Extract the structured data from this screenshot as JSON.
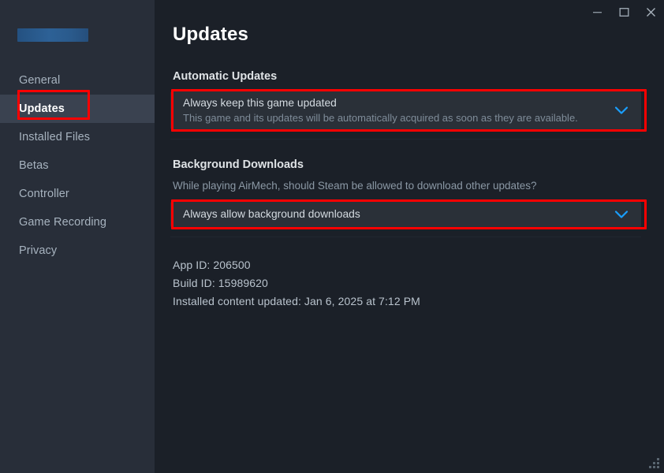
{
  "window": {
    "controls": [
      {
        "name": "minimize",
        "glyph": "minimize-icon"
      },
      {
        "name": "maximize",
        "glyph": "maximize-icon"
      },
      {
        "name": "close",
        "glyph": "close-icon"
      }
    ]
  },
  "sidebar": {
    "game_title_redacted": "",
    "items": [
      {
        "label": "General",
        "active": false
      },
      {
        "label": "Updates",
        "active": true
      },
      {
        "label": "Installed Files",
        "active": false
      },
      {
        "label": "Betas",
        "active": false
      },
      {
        "label": "Controller",
        "active": false
      },
      {
        "label": "Game Recording",
        "active": false
      },
      {
        "label": "Privacy",
        "active": false
      }
    ]
  },
  "main": {
    "page_title": "Updates",
    "automatic_updates": {
      "section_label": "Automatic Updates",
      "selected_option": "Always keep this game updated",
      "selected_description": "This game and its updates will be automatically acquired as soon as they are available.",
      "chevron": "chevron-down-icon"
    },
    "background_downloads": {
      "section_label": "Background Downloads",
      "section_description": "While playing AirMech, should Steam be allowed to download other updates?",
      "selected_option": "Always allow background downloads",
      "chevron": "chevron-down-icon"
    },
    "info": {
      "app_id": "App ID: 206500",
      "build_id": "Build ID: 15989620",
      "installed_content_updated": "Installed content updated: Jan 6, 2025 at 7:12 PM"
    }
  },
  "annotations": {
    "highlight_color": "#fe0000",
    "boxes": [
      {
        "name": "sidebar-updates-highlight"
      },
      {
        "name": "automatic-updates-dropdown-highlight"
      },
      {
        "name": "background-downloads-dropdown-highlight"
      }
    ]
  },
  "colors": {
    "sidebar_bg": "#282e39",
    "content_bg": "#1b2028",
    "active_nav_bg": "#3a4250",
    "dropdown_bg": "#2a3038",
    "accent_blue": "#1a9fff",
    "annotation_red": "#fe0000"
  }
}
